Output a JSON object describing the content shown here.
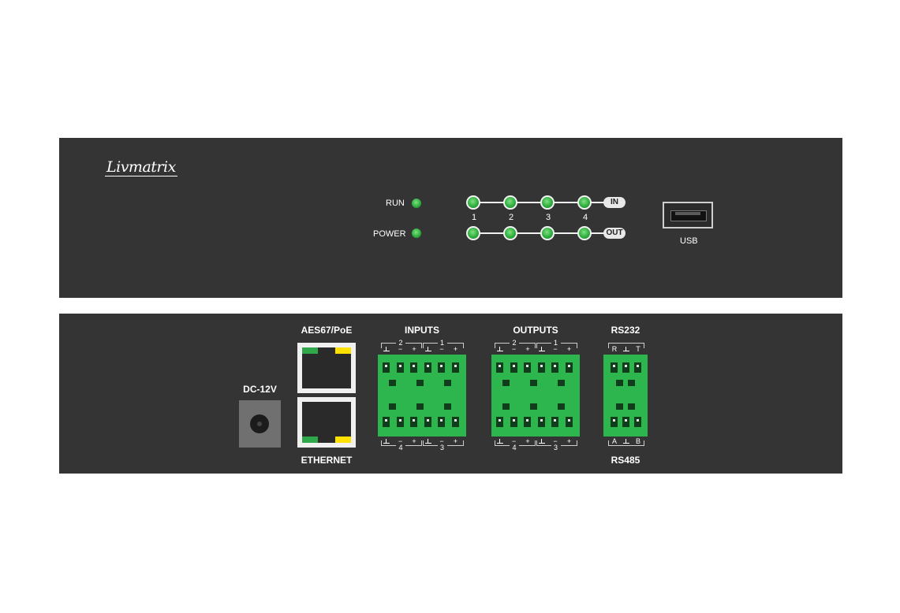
{
  "front": {
    "brand": "Livmatrix",
    "status_leds": [
      {
        "label": "RUN"
      },
      {
        "label": "POWER"
      }
    ],
    "channel_numbers": [
      "1",
      "2",
      "3",
      "4"
    ],
    "in_tag": "IN",
    "out_tag": "OUT",
    "usb_label": "USB"
  },
  "rear": {
    "dc_label": "DC-12V",
    "aes67_label": "AES67/PoE",
    "ethernet_label": "ETHERNET",
    "inputs_label": "INPUTS",
    "outputs_label": "OUTPUTS",
    "rs232_label": "RS232",
    "rs485_label": "RS485",
    "in_top_groups": [
      "2",
      "1"
    ],
    "in_bottom_groups": [
      "4",
      "3"
    ],
    "out_top_groups": [
      "2",
      "1"
    ],
    "out_bottom_groups": [
      "4",
      "3"
    ],
    "pin_minus": "−",
    "pin_plus": "+",
    "rs232_pins": [
      "R",
      "T"
    ],
    "rs485_pins": [
      "A",
      "B"
    ]
  },
  "colors": {
    "panel": "#343434",
    "led_green": "#2fae3f",
    "terminal_green": "#2db64d",
    "port_yellow": "#ffe100"
  }
}
